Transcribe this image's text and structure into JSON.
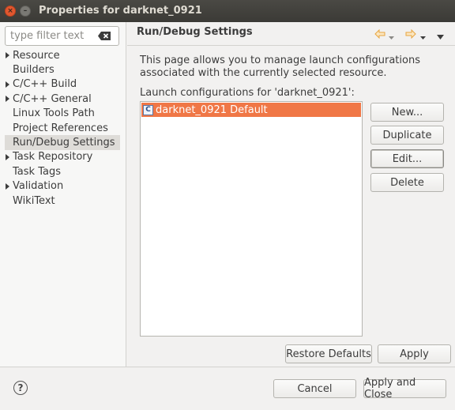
{
  "window": {
    "title": "Properties for darknet_0921",
    "close_glyph": "×",
    "minimize_glyph": "–"
  },
  "filter": {
    "placeholder": "type filter text"
  },
  "tree": {
    "items": [
      {
        "label": "Resource",
        "expandable": true,
        "selected": false
      },
      {
        "label": "Builders",
        "expandable": false,
        "selected": false
      },
      {
        "label": "C/C++ Build",
        "expandable": true,
        "selected": false
      },
      {
        "label": "C/C++ General",
        "expandable": true,
        "selected": false
      },
      {
        "label": "Linux Tools Path",
        "expandable": false,
        "selected": false
      },
      {
        "label": "Project References",
        "expandable": false,
        "selected": false
      },
      {
        "label": "Run/Debug Settings",
        "expandable": false,
        "selected": true
      },
      {
        "label": "Task Repository",
        "expandable": true,
        "selected": false
      },
      {
        "label": "Task Tags",
        "expandable": false,
        "selected": false
      },
      {
        "label": "Validation",
        "expandable": true,
        "selected": false
      },
      {
        "label": "WikiText",
        "expandable": false,
        "selected": false
      }
    ]
  },
  "page": {
    "title": "Run/Debug Settings",
    "description": "This page allows you to manage launch configurations associated with the currently selected resource.",
    "list_label": "Launch configurations for 'darknet_0921':",
    "configurations": [
      {
        "label": "darknet_0921 Default",
        "icon": "c-file-icon",
        "icon_glyph": "C",
        "selected": true
      }
    ]
  },
  "buttons": {
    "new": "New...",
    "duplicate": "Duplicate",
    "edit": "Edit...",
    "delete": "Delete",
    "restore_defaults": "Restore Defaults",
    "apply": "Apply",
    "cancel": "Cancel",
    "apply_and_close": "Apply and Close"
  },
  "help_glyph": "?",
  "colors": {
    "selection": "#f07746",
    "titlebar": "#3b3a36",
    "close_button": "#e2572f",
    "nav_arrow": "#e8a53f"
  },
  "icons": [
    "close-icon",
    "minimize-icon",
    "clear-filter-icon",
    "back-icon",
    "back-menu-icon",
    "forward-icon",
    "forward-menu-icon",
    "view-menu-icon",
    "c-file-icon",
    "help-icon"
  ]
}
